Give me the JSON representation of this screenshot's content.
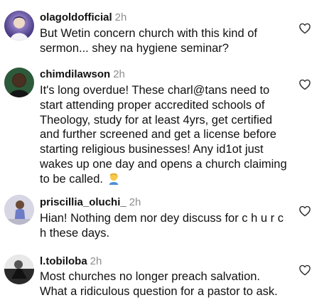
{
  "comments": [
    {
      "username": "olagoldofficial",
      "time": "2h",
      "text": "But Wetin concern church with this kind of\nsermon... shey na hygiene seminar?",
      "avatar_icon": "user-avatar-purple",
      "like_icon": "heart-outline-icon"
    },
    {
      "username": "chimdilawson",
      "time": "2h",
      "text": "It's long overdue! These charl@tans need to\nstart attending proper accredited schools of\nTheology, study for at least 4yrs, get certified\nand further screened and get a license before\nstarting religious businesses! Any id1ot just\nwakes up one day and opens a church claiming\nto be called.",
      "emoji_icon": "person-facepalming-emoji",
      "avatar_icon": "user-avatar-dark",
      "like_icon": "heart-outline-icon"
    },
    {
      "username": "priscillia_oluchi_",
      "time": "2h",
      "text": "Hian! Nothing dem nor dey discuss for c h u r c\nh these days.",
      "avatar_icon": "user-avatar-photo",
      "like_icon": "heart-outline-icon"
    },
    {
      "username": "l.tobiloba",
      "time": "2h",
      "text": "Most churches no longer preach salvation.\nWhat a ridiculous question for a pastor to ask.",
      "avatar_icon": "user-avatar-bw",
      "like_icon": "heart-outline-icon"
    }
  ],
  "colors": {
    "text": "#111111",
    "muted": "#8e8e8e",
    "background": "#ffffff"
  }
}
